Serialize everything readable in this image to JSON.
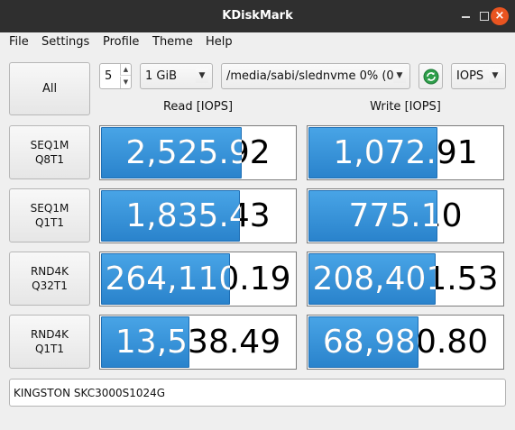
{
  "window": {
    "title": "KDiskMark"
  },
  "menu": [
    "File",
    "Settings",
    "Profile",
    "Theme",
    "Help"
  ],
  "controls": {
    "all_label": "All",
    "loops": "5",
    "size": "1 GiB",
    "target": "/media/sabi/slednvme 0% (0",
    "mode": "IOPS"
  },
  "headers": {
    "read": "Read [IOPS]",
    "write": "Write [IOPS]"
  },
  "tests": [
    {
      "line1": "SEQ1M",
      "line2": "Q8T1",
      "read": "2,525.92",
      "read_fill": 0.72,
      "write": "1,072.91",
      "write_fill": 0.66
    },
    {
      "line1": "SEQ1M",
      "line2": "Q1T1",
      "read": "1,835.43",
      "read_fill": 0.71,
      "write": "775.10",
      "write_fill": 0.66
    },
    {
      "line1": "RND4K",
      "line2": "Q32T1",
      "read": "264,110.19",
      "read_fill": 0.66,
      "write": "208,401.53",
      "write_fill": 0.65
    },
    {
      "line1": "RND4K",
      "line2": "Q1T1",
      "read": "13,538.49",
      "read_fill": 0.45,
      "write": "68,980.80",
      "write_fill": 0.56
    }
  ],
  "comment": {
    "value": "KINGSTON SKC3000S1024G"
  },
  "colors": {
    "bar": "#2f8ad4",
    "titlebar": "#2f2f2f",
    "close": "#e95420",
    "refresh": "#2e9e4a"
  }
}
